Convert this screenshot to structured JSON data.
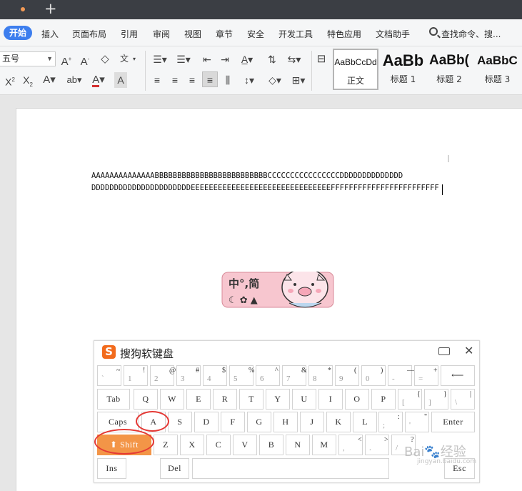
{
  "menu": {
    "tabs": [
      "开始",
      "插入",
      "页面布局",
      "引用",
      "审阅",
      "视图",
      "章节",
      "安全",
      "开发工具",
      "特色应用",
      "文档助手"
    ],
    "search": "查找命令、搜..."
  },
  "ribbon": {
    "font_size": "五号",
    "styles": [
      {
        "sample": "AaBbCcDd",
        "name": "正文"
      },
      {
        "sample": "AaBb",
        "name": "标题 1"
      },
      {
        "sample": "AaBb(",
        "name": "标题 2"
      },
      {
        "sample": "AaBbC",
        "name": "标题 3"
      }
    ]
  },
  "document": {
    "line1": "AAAAAAAAAAAAAABBBBBBBBBBBBBBBBBBBBBBBBBCCCCCCCCCCCCCCCCDDDDDDDDDDDDDD",
    "line2": "DDDDDDDDDDDDDDDDDDDDDDEEEEEEEEEEEEEEEEEEEEEEEEEEEEEEEFFFFFFFFFFFFFFFFFFFFFFFF"
  },
  "ime": {
    "label": "中°,简"
  },
  "keyboard": {
    "title": "搜狗软键盘",
    "logo": "S",
    "close": "✕",
    "row1": [
      {
        "up": "~",
        "lo": "`"
      },
      {
        "up": "!",
        "lo": "1"
      },
      {
        "up": "@",
        "lo": "2"
      },
      {
        "up": "#",
        "lo": "3"
      },
      {
        "up": "$",
        "lo": "4"
      },
      {
        "up": "%",
        "lo": "5"
      },
      {
        "up": "^",
        "lo": "6"
      },
      {
        "up": "&",
        "lo": "7"
      },
      {
        "up": "*",
        "lo": "8"
      },
      {
        "up": "(",
        "lo": "9"
      },
      {
        "up": ")",
        "lo": "0"
      },
      {
        "up": "—",
        "lo": "-"
      },
      {
        "up": "+",
        "lo": "="
      }
    ],
    "backspace": "⟵",
    "row2": [
      "Tab",
      "Q",
      "W",
      "E",
      "R",
      "T",
      "Y",
      "U",
      "I",
      "O",
      "P"
    ],
    "row2_sym": [
      {
        "up": "{",
        "lo": "["
      },
      {
        "up": "}",
        "lo": "]"
      },
      {
        "up": "|",
        "lo": "\\"
      }
    ],
    "row3": [
      "Caps",
      "A",
      "S",
      "D",
      "F",
      "G",
      "H",
      "J",
      "K",
      "L"
    ],
    "row3_sym": [
      {
        "up": ":",
        "lo": ";"
      },
      {
        "up": "\"",
        "lo": "'"
      }
    ],
    "enter": "Enter",
    "shift": "⬆ Shift",
    "row4": [
      "Z",
      "X",
      "C",
      "V",
      "B",
      "N",
      "M"
    ],
    "row4_sym": [
      {
        "up": "<",
        "lo": ","
      },
      {
        "up": ">",
        "lo": "."
      },
      {
        "up": "?",
        "lo": "/"
      }
    ],
    "ins": "Ins",
    "del": "Del",
    "esc": "Esc"
  },
  "watermark": {
    "text": "Bai🐾经验",
    "sub": "jingyan.baidu.com"
  }
}
